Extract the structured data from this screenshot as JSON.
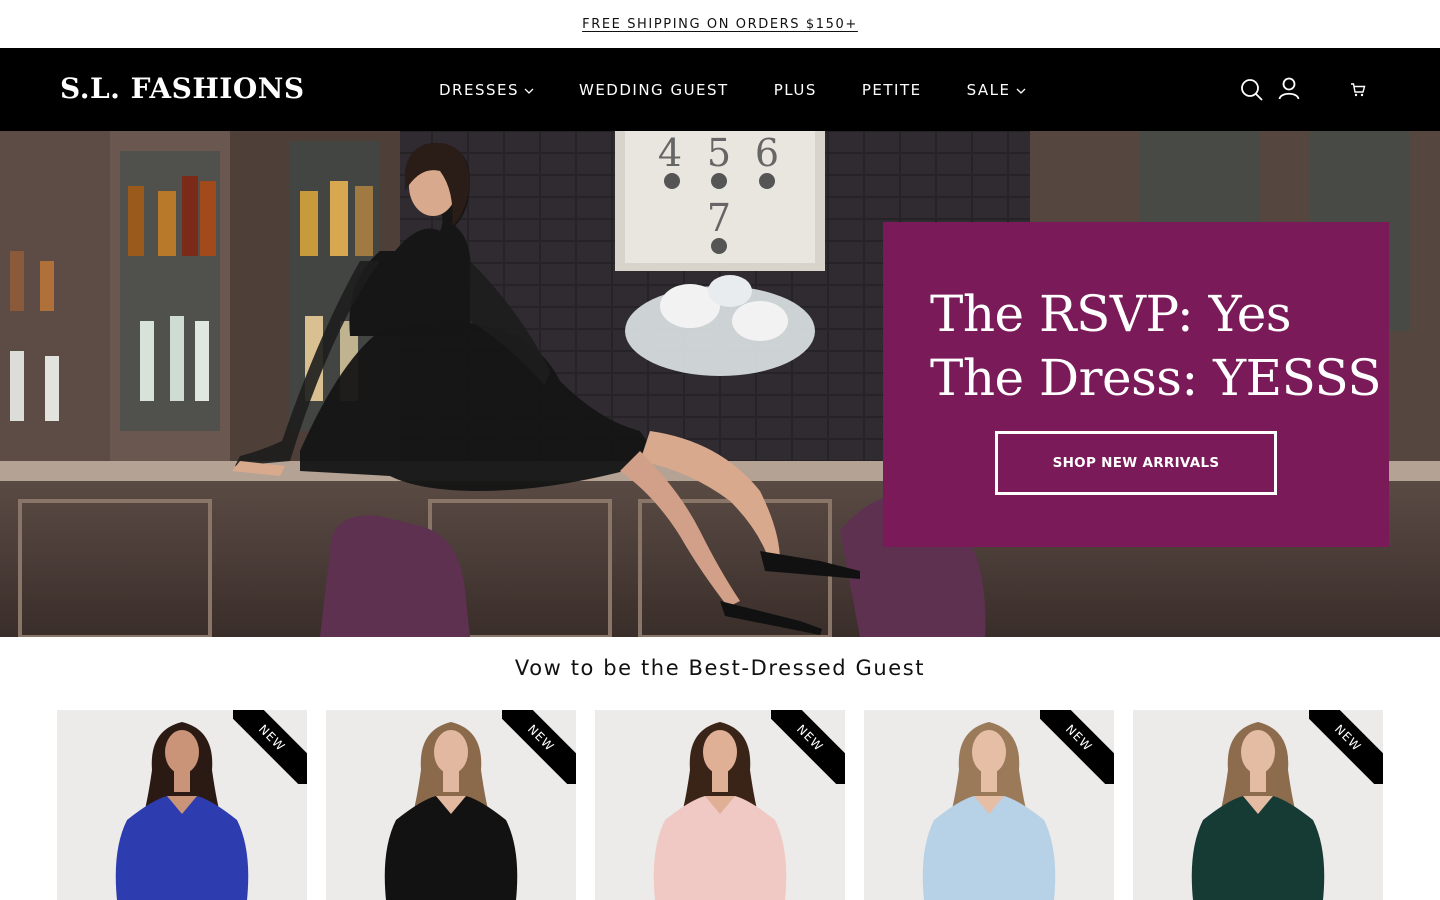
{
  "announcement": {
    "text": "FREE SHIPPING ON ORDERS $150+"
  },
  "header": {
    "logo": "S.L. FASHIONS",
    "nav": [
      {
        "label": "DRESSES",
        "dropdown": true
      },
      {
        "label": "WEDDING GUEST",
        "dropdown": false
      },
      {
        "label": "PLUS",
        "dropdown": false
      },
      {
        "label": "PETITE",
        "dropdown": false
      },
      {
        "label": "SALE",
        "dropdown": true
      }
    ],
    "icons": [
      "search-icon",
      "account-icon",
      "cart-icon"
    ]
  },
  "hero": {
    "headline_line1": "The RSVP: Yes",
    "headline_line2": "The Dress: YESSS",
    "button_label": "SHOP NEW ARRIVALS",
    "panel_color": "#7a1a58",
    "wall_numbers": [
      "4",
      "5",
      "6",
      "7"
    ]
  },
  "section": {
    "title": "Vow to be the Best-Dressed Guest"
  },
  "products": [
    {
      "badge": "NEW",
      "dress_color": "#2d3db0"
    },
    {
      "badge": "NEW",
      "dress_color": "#121212"
    },
    {
      "badge": "NEW",
      "dress_color": "#f0c8c4"
    },
    {
      "badge": "NEW",
      "dress_color": "#b7d1e6"
    },
    {
      "badge": "NEW",
      "dress_color": "#163a34"
    }
  ],
  "colors": {
    "header_bg": "#000000",
    "text": "#111111",
    "accent": "#7a1a58"
  }
}
